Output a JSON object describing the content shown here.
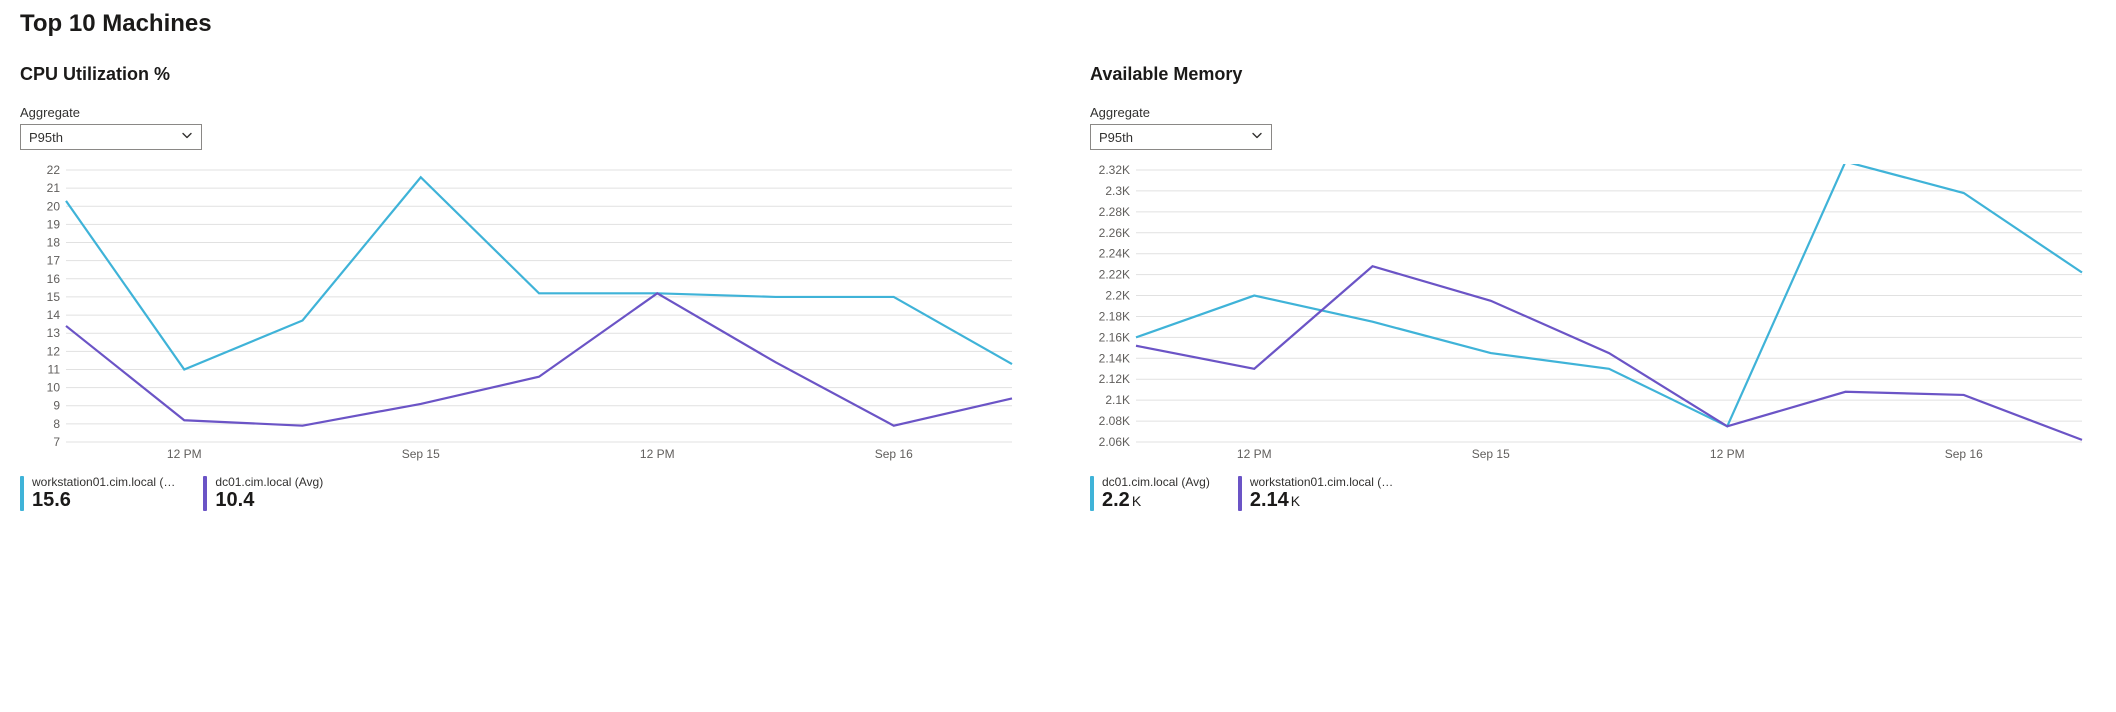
{
  "title": "Top 10 Machines",
  "panels": {
    "cpu": {
      "title": "CPU Utilization %",
      "aggregate_label": "Aggregate",
      "aggregate_value": "P95th",
      "legend": [
        {
          "name": "workstation01.cim.local (…",
          "value": "15.6",
          "suffix": "",
          "color": "#3fb3d8"
        },
        {
          "name": "dc01.cim.local (Avg)",
          "value": "10.4",
          "suffix": "",
          "color": "#6b54c6"
        }
      ]
    },
    "memory": {
      "title": "Available Memory",
      "aggregate_label": "Aggregate",
      "aggregate_value": "P95th",
      "legend": [
        {
          "name": "dc01.cim.local (Avg)",
          "value": "2.2",
          "suffix": "K",
          "color": "#3fb3d8"
        },
        {
          "name": "workstation01.cim.local (…",
          "value": "2.14",
          "suffix": "K",
          "color": "#6b54c6"
        }
      ]
    }
  },
  "chart_data": [
    {
      "id": "cpu",
      "type": "line",
      "title": "CPU Utilization %",
      "xlabel": "",
      "ylabel": "",
      "ylim": [
        7,
        22
      ],
      "y_ticks": [
        7,
        8,
        9,
        10,
        11,
        12,
        13,
        14,
        15,
        16,
        17,
        18,
        19,
        20,
        21,
        22
      ],
      "x_tick_labels": [
        "",
        "12 PM",
        "",
        "Sep 15",
        "",
        "12 PM",
        "",
        "Sep 16",
        ""
      ],
      "series": [
        {
          "name": "workstation01.cim.local",
          "color": "#3fb3d8",
          "values": [
            20.3,
            11.0,
            13.7,
            21.6,
            15.2,
            15.2,
            15.0,
            15.0,
            11.3
          ]
        },
        {
          "name": "dc01.cim.local",
          "color": "#6b54c6",
          "values": [
            13.4,
            8.2,
            7.9,
            9.1,
            10.6,
            15.2,
            11.4,
            7.9,
            9.4
          ]
        }
      ]
    },
    {
      "id": "memory",
      "type": "line",
      "title": "Available Memory",
      "xlabel": "",
      "ylabel": "",
      "ylim": [
        2060,
        2320
      ],
      "y_ticks": [
        2060,
        2080,
        2100,
        2120,
        2140,
        2160,
        2180,
        2200,
        2220,
        2240,
        2260,
        2280,
        2300,
        2320
      ],
      "y_tick_labels": [
        "2.06K",
        "2.08K",
        "2.1K",
        "2.12K",
        "2.14K",
        "2.16K",
        "2.18K",
        "2.2K",
        "2.22K",
        "2.24K",
        "2.26K",
        "2.28K",
        "2.3K",
        "2.32K"
      ],
      "x_tick_labels": [
        "",
        "12 PM",
        "",
        "Sep 15",
        "",
        "12 PM",
        "",
        "Sep 16",
        ""
      ],
      "series": [
        {
          "name": "dc01.cim.local",
          "color": "#3fb3d8",
          "values": [
            2160,
            2200,
            2175,
            2145,
            2130,
            2075,
            2328,
            2298,
            2222
          ]
        },
        {
          "name": "workstation01.cim.local",
          "color": "#6b54c6",
          "values": [
            2152,
            2130,
            2228,
            2195,
            2145,
            2075,
            2108,
            2105,
            2062
          ]
        }
      ]
    }
  ]
}
